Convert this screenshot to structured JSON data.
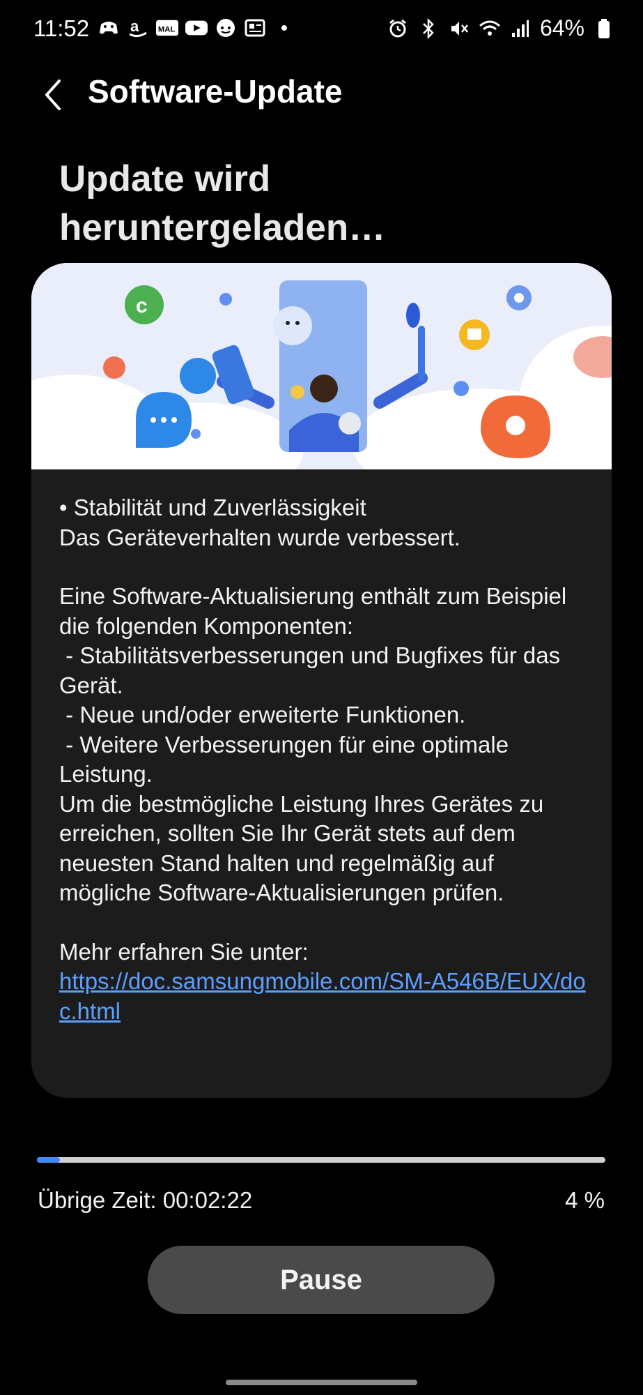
{
  "status_bar": {
    "time": "11:52",
    "battery": "64%"
  },
  "header": {
    "title": "Software-Update"
  },
  "download": {
    "title": "Update wird heruntergeladen…"
  },
  "release_notes": {
    "bullet": "• Stabilität und Zuverlässigkeit",
    "bullet_detail": "Das Geräteverhalten wurde verbessert.",
    "intro": "Eine Software-Aktualisierung enthält zum Beispiel die folgenden Komponenten:",
    "item1": " - Stabilitätsverbesserungen und Bugfixes für das Gerät.",
    "item2": " - Neue und/oder erweiterte Funktionen.",
    "item3": " - Weitere Verbesserungen für eine optimale Leistung.",
    "advice": "Um die bestmögliche Leistung Ihres Gerätes zu erreichen, sollten Sie Ihr Gerät stets auf dem neuesten Stand halten und regelmäßig auf mögliche Software-Aktualisierungen prüfen.",
    "more_label": "Mehr erfahren Sie unter:",
    "link": "https://doc.samsungmobile.com/SM-A546B/EUX/doc.html"
  },
  "progress": {
    "value_percent": 4,
    "remaining": "Übrige Zeit: 00:02:22",
    "percent_label": "4 %"
  },
  "actions": {
    "pause_label": "Pause"
  },
  "colors": {
    "background": "#000000",
    "card": "#1c1c1c",
    "accent": "#3e8bff",
    "link": "#5ba0ff",
    "button": "#4a4a4a"
  }
}
